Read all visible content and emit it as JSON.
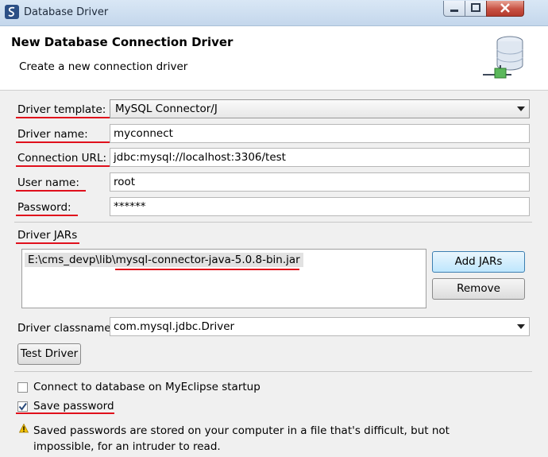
{
  "window": {
    "title": "Database Driver"
  },
  "header": {
    "title": "New Database Connection Driver",
    "description": "Create a new connection driver"
  },
  "form": {
    "driver_template": {
      "label": "Driver template:",
      "value": "MySQL Connector/J"
    },
    "driver_name": {
      "label": "Driver name:",
      "value": "myconnect"
    },
    "connection_url": {
      "label": "Connection URL:",
      "value": "jdbc:mysql://localhost:3306/test"
    },
    "user_name": {
      "label": "User name:",
      "value": "root"
    },
    "password": {
      "label": "Password:",
      "value": "******"
    }
  },
  "jars": {
    "label": "Driver JARs",
    "items": [
      "E:\\cms_devp\\lib\\mysql-connector-java-5.0.8-bin.jar"
    ],
    "add_label": "Add JARs",
    "remove_label": "Remove"
  },
  "classname": {
    "label": "Driver classname:",
    "value": "com.mysql.jdbc.Driver"
  },
  "test_driver_label": "Test Driver",
  "options": {
    "connect_startup": {
      "label": "Connect to database on MyEclipse startup",
      "checked": false
    },
    "save_password": {
      "label": "Save password",
      "checked": true
    }
  },
  "warning": "Saved passwords are stored on your computer in a file that's difficult, but not impossible, for an intruder to read.",
  "colors": {
    "annotation_red": "#e0101c",
    "titlebar": "#c4d7ec"
  }
}
